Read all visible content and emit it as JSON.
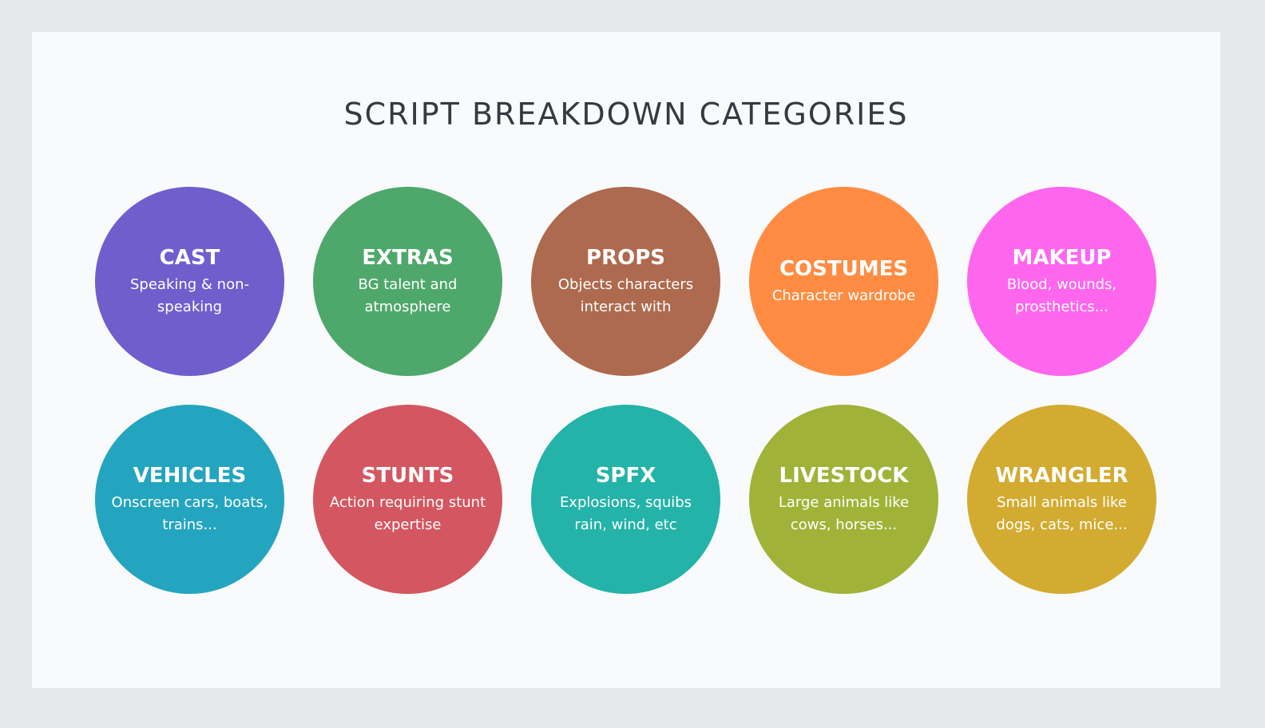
{
  "title": "SCRIPT BREAKDOWN CATEGORIES",
  "categories": [
    {
      "name": "CAST",
      "desc_lines": [
        "Speaking & non-",
        "speaking"
      ],
      "color": "#715ecd"
    },
    {
      "name": "EXTRAS",
      "desc_lines": [
        "BG talent and",
        "atmosphere"
      ],
      "color": "#4fa86b"
    },
    {
      "name": "PROPS",
      "desc_lines": [
        "Objects characters",
        "interact with"
      ],
      "color": "#ae6a4e"
    },
    {
      "name": "COSTUMES",
      "desc_lines": [
        "Character wardrobe"
      ],
      "color": "#ff8c42"
    },
    {
      "name": "MAKEUP",
      "desc_lines": [
        "Blood, wounds,",
        "prosthetics..."
      ],
      "color": "#ff66ee"
    },
    {
      "name": "VEHICLES",
      "desc_lines": [
        "Onscreen cars, boats,",
        "trains..."
      ],
      "color": "#24a5bf"
    },
    {
      "name": "STUNTS",
      "desc_lines": [
        "Action requiring stunt",
        "expertise"
      ],
      "color": "#d45660"
    },
    {
      "name": "SPFX",
      "desc_lines": [
        "Explosions, squibs",
        "rain, wind, etc"
      ],
      "color": "#24b3a8"
    },
    {
      "name": "LIVESTOCK",
      "desc_lines": [
        "Large animals like",
        "cows, horses..."
      ],
      "color": "#a0b338"
    },
    {
      "name": "WRANGLER",
      "desc_lines": [
        "Small animals like",
        "dogs, cats, mice..."
      ],
      "color": "#d2ab30"
    }
  ]
}
